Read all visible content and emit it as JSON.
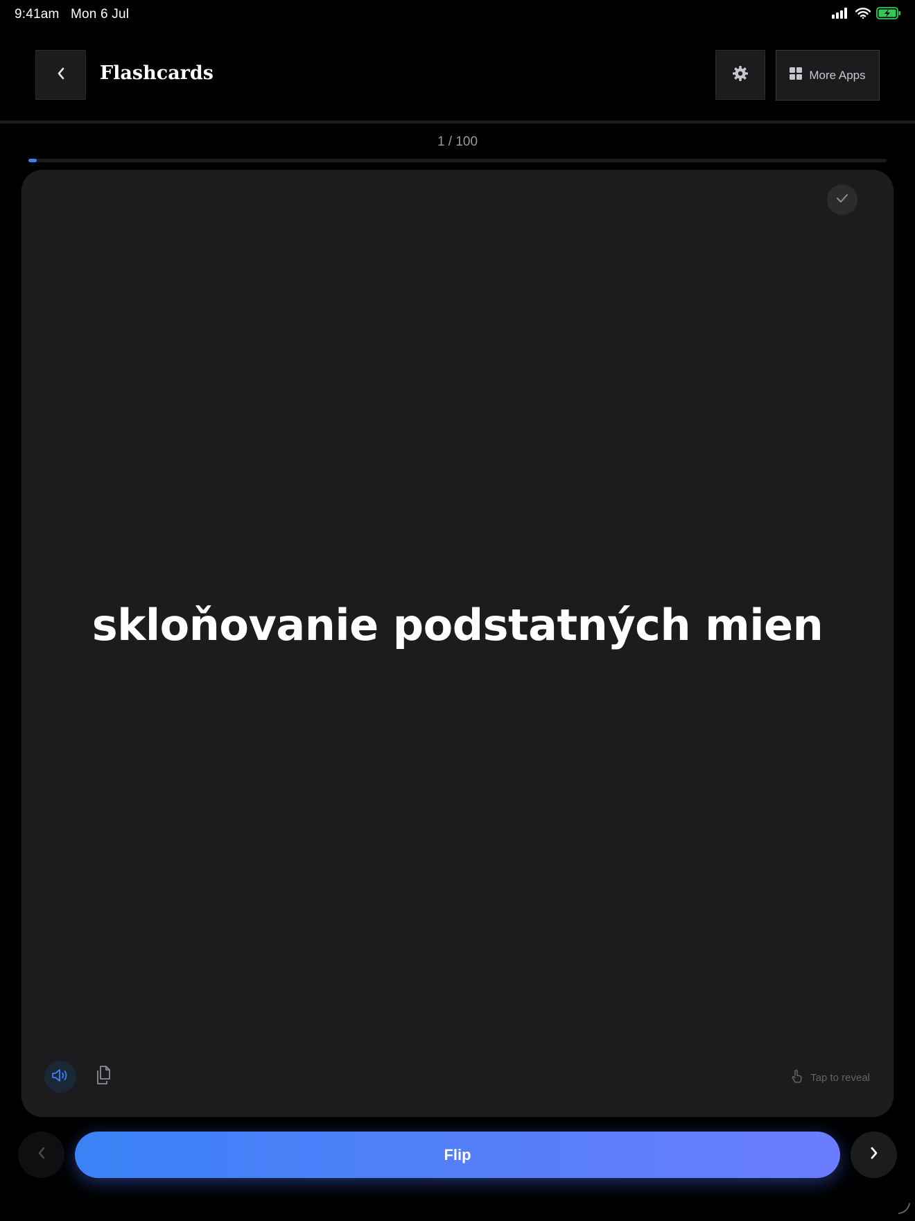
{
  "status_bar": {
    "time": "9:41am",
    "date": "Mon 6 Jul",
    "icons": [
      "signal-icon",
      "wifi-icon",
      "battery-charging-icon"
    ]
  },
  "header": {
    "title": "Flashcards",
    "back_icon": "chevron-left-icon",
    "settings_icon": "gear-icon",
    "more_apps_label": "More Apps",
    "more_apps_icon": "grid-icon"
  },
  "progress": {
    "label": "1 / 100",
    "current": 1,
    "total": 100
  },
  "card": {
    "term": "skloňovanie podstatných mien",
    "known_icon": "checkmark-icon",
    "speak_icon": "speaker-icon",
    "copy_icon": "copy-icon",
    "hint": "Tap to reveal",
    "hint_icon": "tap-hand-icon"
  },
  "nav": {
    "prev_icon": "chevron-left-icon",
    "flip_label": "Flip",
    "next_icon": "chevron-right-icon"
  },
  "colors": {
    "background": "#000000",
    "surface": "#1c1c1e",
    "accent": "#3b82f6",
    "accent_end": "#6b7cff",
    "battery": "#34c759"
  }
}
